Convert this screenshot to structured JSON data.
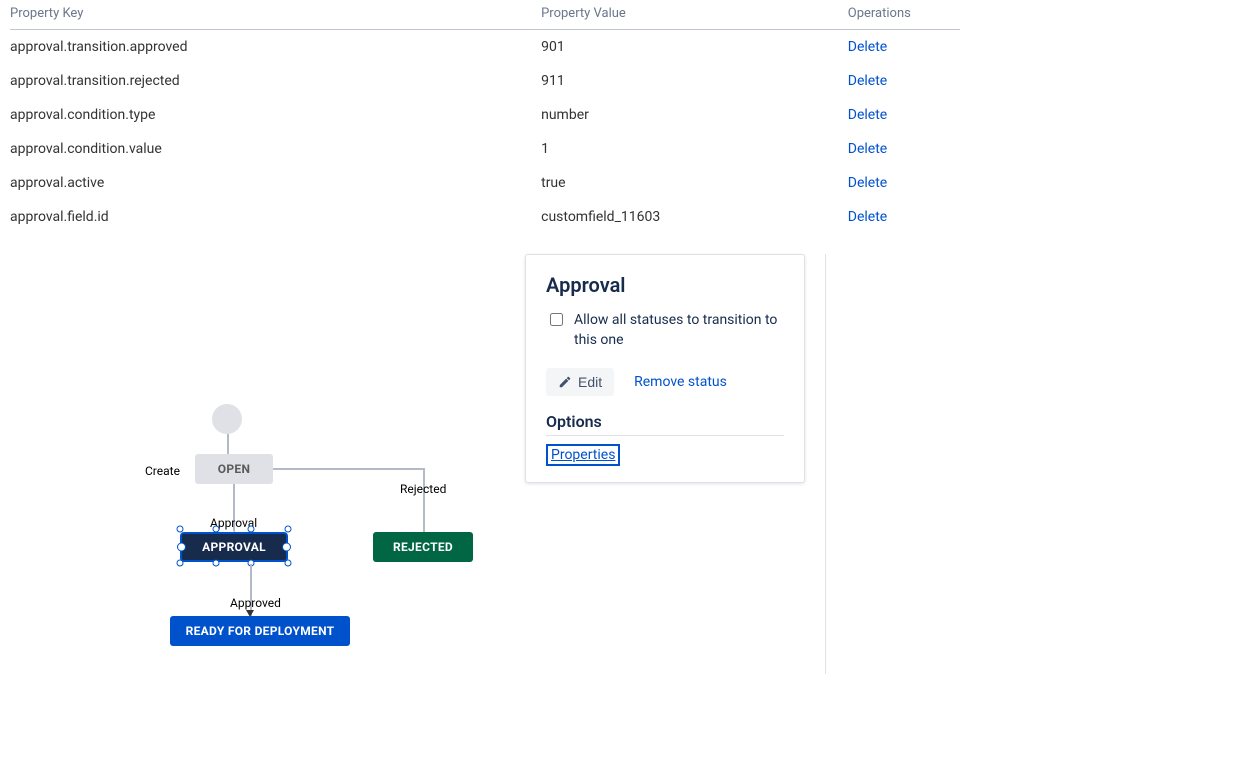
{
  "table": {
    "headers": {
      "key": "Property Key",
      "value": "Property Value",
      "ops": "Operations"
    },
    "rows": [
      {
        "key": "approval.transition.approved",
        "value": "901",
        "op": "Delete"
      },
      {
        "key": "approval.transition.rejected",
        "value": "911",
        "op": "Delete"
      },
      {
        "key": "approval.condition.type",
        "value": "number",
        "op": "Delete"
      },
      {
        "key": "approval.condition.value",
        "value": "1",
        "op": "Delete"
      },
      {
        "key": "approval.active",
        "value": "true",
        "op": "Delete"
      },
      {
        "key": "approval.field.id",
        "value": "customfield_11603",
        "op": "Delete"
      }
    ]
  },
  "workflow": {
    "transitions": {
      "create": "Create",
      "approval": "Approval",
      "rejected": "Rejected",
      "approved": "Approved"
    },
    "statuses": {
      "open": "OPEN",
      "approval": "APPROVAL",
      "rejected": "REJECTED",
      "ready": "READY FOR DEPLOYMENT"
    }
  },
  "panel": {
    "title": "Approval",
    "allow_all_label": "Allow all statuses to transition to this one",
    "edit_label": "Edit",
    "remove_label": "Remove status",
    "options_heading": "Options",
    "properties_link": "Properties"
  }
}
